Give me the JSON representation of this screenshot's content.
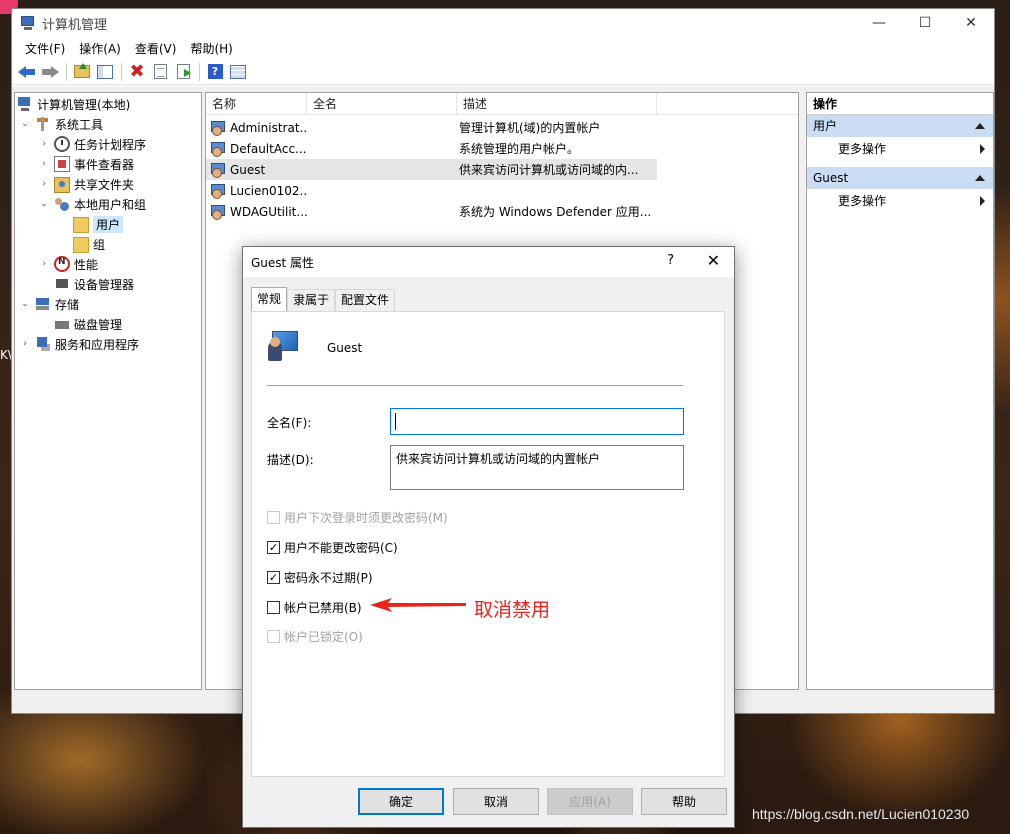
{
  "window": {
    "title": "计算机管理",
    "controls": {
      "minimize": "—",
      "maximize": "☐",
      "close": "✕"
    }
  },
  "menu": [
    "文件(F)",
    "操作(A)",
    "查看(V)",
    "帮助(H)"
  ],
  "toolbar": {
    "icons": [
      "back-icon",
      "forward-icon",
      "folder-up-icon",
      "console-tree-icon",
      "delete-icon",
      "properties-icon",
      "export-icon",
      "help-icon",
      "action-pane-icon"
    ],
    "help_glyph": "?"
  },
  "tree": [
    {
      "label": "计算机管理(本地)",
      "expander": "",
      "icon": "computer"
    },
    {
      "label": "系统工具",
      "expander": "⌄",
      "icon": "tools"
    },
    {
      "label": "任务计划程序",
      "expander": "›",
      "icon": "clock"
    },
    {
      "label": "事件查看器",
      "expander": "›",
      "icon": "event"
    },
    {
      "label": "共享文件夹",
      "expander": "›",
      "icon": "share"
    },
    {
      "label": "本地用户和组",
      "expander": "⌄",
      "icon": "users"
    },
    {
      "label": "用户",
      "expander": "",
      "icon": "folder"
    },
    {
      "label": "组",
      "expander": "",
      "icon": "folder"
    },
    {
      "label": "性能",
      "expander": "›",
      "icon": "perf"
    },
    {
      "label": "设备管理器",
      "expander": "",
      "icon": "device"
    },
    {
      "label": "存储",
      "expander": "⌄",
      "icon": "storage"
    },
    {
      "label": "磁盘管理",
      "expander": "",
      "icon": "disk"
    },
    {
      "label": "服务和应用程序",
      "expander": "›",
      "icon": "services"
    }
  ],
  "list": {
    "columns": [
      "名称",
      "全名",
      "描述"
    ],
    "rows": [
      {
        "name": "Administrat...",
        "full": "",
        "desc": "管理计算机(域)的内置帐户"
      },
      {
        "name": "DefaultAcc...",
        "full": "",
        "desc": "系统管理的用户帐户。"
      },
      {
        "name": "Guest",
        "full": "",
        "desc": "供来宾访问计算机或访问域的内..."
      },
      {
        "name": "Lucien0102...",
        "full": "",
        "desc": ""
      },
      {
        "name": "WDAGUtilit...",
        "full": "",
        "desc": "系统为 Windows Defender 应用..."
      }
    ]
  },
  "actions": {
    "title": "操作",
    "sections": [
      {
        "label": "用户",
        "item": "更多操作"
      },
      {
        "label": "Guest",
        "item": "更多操作"
      }
    ]
  },
  "dialog": {
    "title": "Guest 属性",
    "help": "?",
    "close": "✕",
    "tabs": [
      "常规",
      "隶属于",
      "配置文件"
    ],
    "user_name": "Guest",
    "fullname_label": "全名(F):",
    "fullname_value": "",
    "desc_label": "描述(D):",
    "desc_value": "供来宾访问计算机或访问域的内置帐户",
    "checks": [
      {
        "label": "用户下次登录时须更改密码(M)",
        "checked": false,
        "disabled": true
      },
      {
        "label": "用户不能更改密码(C)",
        "checked": true,
        "disabled": false
      },
      {
        "label": "密码永不过期(P)",
        "checked": true,
        "disabled": false
      },
      {
        "label": "帐户已禁用(B)",
        "checked": false,
        "disabled": false
      },
      {
        "label": "帐户已锁定(O)",
        "checked": false,
        "disabled": true
      }
    ],
    "buttons": [
      "确定",
      "取消",
      "应用(A)",
      "帮助"
    ]
  },
  "annotation": {
    "text": "取消禁用",
    "color": "#e8241c"
  },
  "watermark": "https://blog.csdn.net/Lucien010230",
  "stray_text": "K\\",
  "colors": {
    "selection": "#cce8ff",
    "action_header": "#c9dcf2",
    "focus": "#0078d7"
  }
}
